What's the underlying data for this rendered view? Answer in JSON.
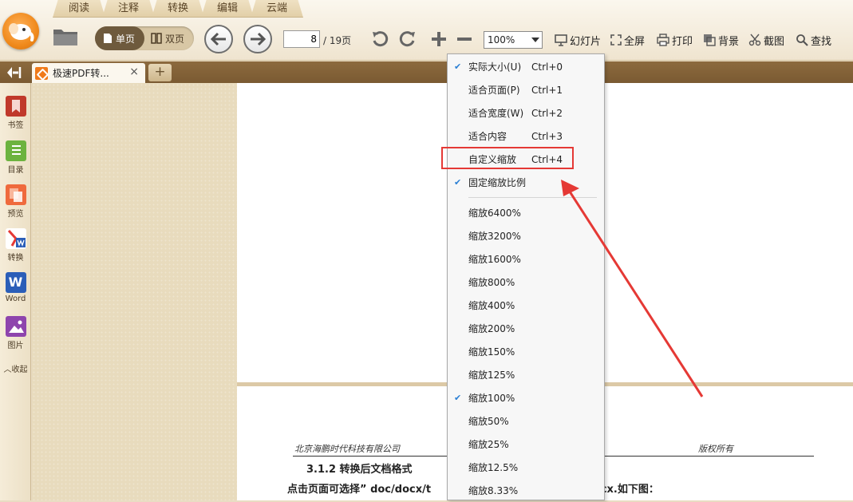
{
  "menu_tabs": [
    "阅读",
    "注释",
    "转换",
    "编辑",
    "云端"
  ],
  "toolbar": {
    "single_page": "单页",
    "double_page": "双页",
    "page_current": "8",
    "page_total": "/ 19页",
    "zoom_value": "100%",
    "slideshow": "幻灯片",
    "fullscreen": "全屏",
    "print": "打印",
    "background": "背景",
    "screenshot": "截图",
    "find": "查找"
  },
  "doc_tab": {
    "title": "极速PDF转...",
    "close": "×",
    "add": "+"
  },
  "sidebar": {
    "items": [
      "书签",
      "目录",
      "预览",
      "转换",
      "Word",
      "图片"
    ],
    "word_letter": "W",
    "collapse": "收起"
  },
  "page": {
    "company": "北京海鹏时代科技有限公司",
    "rights": "版权所有",
    "section_heading": "3.1.2 转换后文档格式",
    "body_line": "点击页面可选择” doc/docx/t",
    "body_line_tail": "建议优先使用 docx.如下图："
  },
  "zoom_menu": {
    "items": [
      {
        "label": "实际大小(U)",
        "shortcut": "Ctrl+0",
        "checked": true
      },
      {
        "label": "适合页面(P)",
        "shortcut": "Ctrl+1",
        "checked": false
      },
      {
        "label": "适合宽度(W)",
        "shortcut": "Ctrl+2",
        "checked": false
      },
      {
        "label": "适合内容",
        "shortcut": "Ctrl+3",
        "checked": false
      },
      {
        "label": "自定义缩放",
        "shortcut": "Ctrl+4",
        "checked": false,
        "highlighted": true
      },
      {
        "label": "固定缩放比例",
        "shortcut": "",
        "checked": true
      },
      {
        "label": "缩放6400%",
        "shortcut": "",
        "checked": false
      },
      {
        "label": "缩放3200%",
        "shortcut": "",
        "checked": false
      },
      {
        "label": "缩放1600%",
        "shortcut": "",
        "checked": false
      },
      {
        "label": "缩放800%",
        "shortcut": "",
        "checked": false
      },
      {
        "label": "缩放400%",
        "shortcut": "",
        "checked": false
      },
      {
        "label": "缩放200%",
        "shortcut": "",
        "checked": false
      },
      {
        "label": "缩放150%",
        "shortcut": "",
        "checked": false
      },
      {
        "label": "缩放125%",
        "shortcut": "",
        "checked": false
      },
      {
        "label": "缩放100%",
        "shortcut": "",
        "checked": true
      },
      {
        "label": "缩放50%",
        "shortcut": "",
        "checked": false
      },
      {
        "label": "缩放25%",
        "shortcut": "",
        "checked": false
      },
      {
        "label": "缩放12.5%",
        "shortcut": "",
        "checked": false
      },
      {
        "label": "缩放8.33%",
        "shortcut": "",
        "checked": false
      }
    ],
    "checkmark": "✔"
  },
  "colors": {
    "annotation": "#e53935",
    "accent": "#f08a1c",
    "check": "#2a7fd4"
  }
}
